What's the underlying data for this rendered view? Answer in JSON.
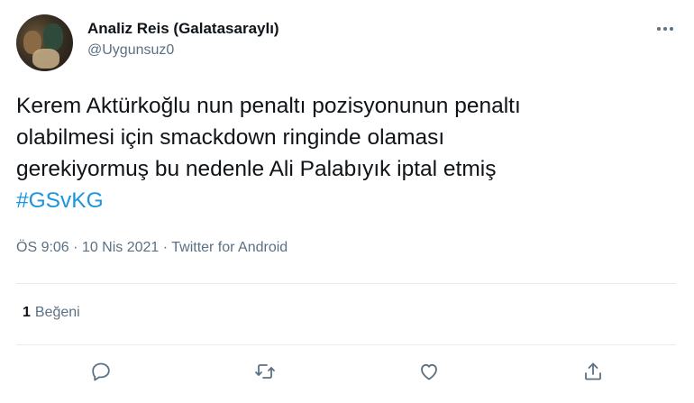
{
  "tweet": {
    "author": {
      "display_name": "Analiz Reis (Galatasaraylı)",
      "handle": "@Uygunsuz0",
      "avatar_icon": "user-avatar"
    },
    "more_icon": "more-icon",
    "text_lines": [
      "Kerem Aktürkoğlu nun penaltı pozisyonunun penaltı",
      "olabilmesi için smackdown ringinde olaması",
      "gerekiyormuş bu nedenle Ali Palabıyık iptal etmiş"
    ],
    "hashtag": "#GSvKG",
    "hashtag_color": "#1b95e0",
    "meta": "ÖS 9:06 · 10 Nis 2021 · Twitter for Android",
    "likes": {
      "count": "1",
      "label": "Beğeni"
    },
    "actions": [
      "reply-icon",
      "retweet-icon",
      "like-icon",
      "share-icon"
    ]
  }
}
